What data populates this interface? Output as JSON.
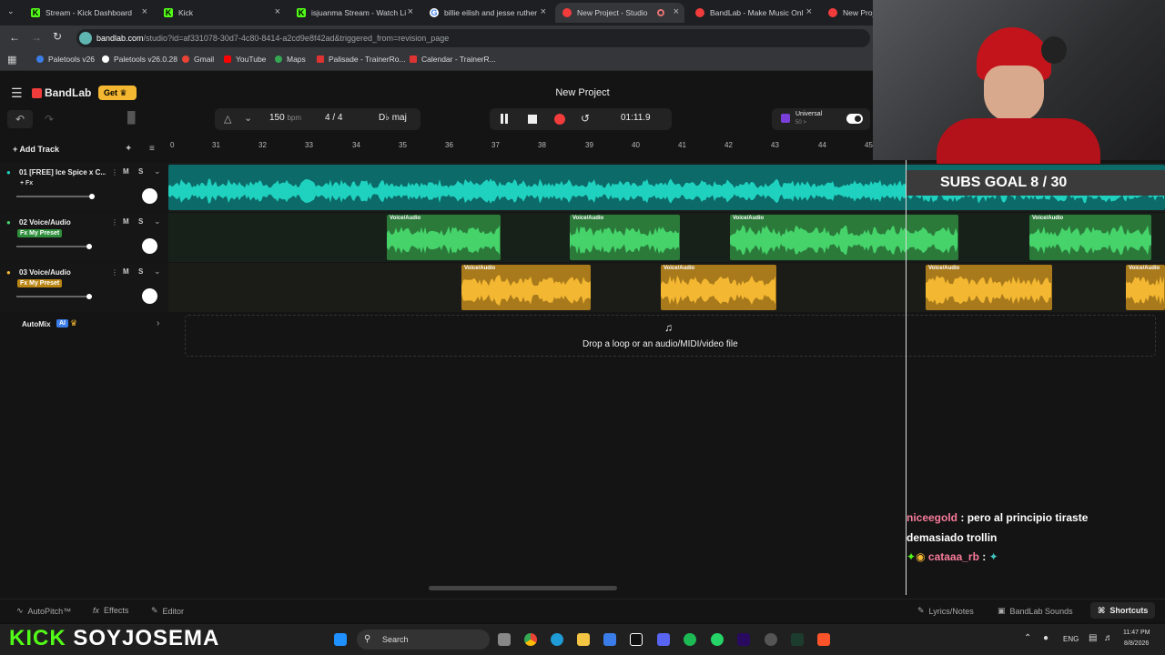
{
  "browser": {
    "tabs": [
      {
        "label": "Stream - Kick Dashboard",
        "favicon": "kick-icon"
      },
      {
        "label": "Kick",
        "favicon": "kick-icon"
      },
      {
        "label": "isjuanma Stream - Watch Li",
        "favicon": "kick-icon"
      },
      {
        "label": "billie eilish and jesse ruther",
        "favicon": "google-icon"
      },
      {
        "label": "New Project - Studio",
        "favicon": "bandlab-icon",
        "active": true
      },
      {
        "label": "BandLab - Make Music Onl",
        "favicon": "bandlab-icon"
      },
      {
        "label": "New Proje",
        "favicon": "bandlab-icon"
      }
    ],
    "url_domain": "bandlab.com",
    "url_rest": "/studio?id=af331078-30d7-4c80-8414-a2cd9e8f42ad&triggered_from=revision_page",
    "bookmarks": [
      "Paletools v26",
      "Paletools v26.0.28",
      "Gmail",
      "YouTube",
      "Maps",
      "Palisade - TrainerRo...",
      "Calendar - TrainerR..."
    ]
  },
  "app": {
    "logo": "BandLab",
    "get_label": "Get",
    "title": "New Project",
    "tempo": "150",
    "tempo_unit": "bpm",
    "time_signature": "4 / 4",
    "key": "D♭ maj",
    "time_display": "01:11.9",
    "instrument_preset": "Universal",
    "instrument_sub": "50 >",
    "add_track_label": "Add Track",
    "drop_hint": "Drop a loop or an audio/MIDI/video file",
    "automix_label": "AutoMix",
    "automix_badge": "AI"
  },
  "ruler": [
    "0",
    "31",
    "32",
    "33",
    "34",
    "35",
    "36",
    "37",
    "38",
    "39",
    "40",
    "41",
    "42",
    "43",
    "44",
    "45"
  ],
  "tracks": [
    {
      "name": "01 [FREE] Ice Spice x C...",
      "fx": "+ Fx",
      "fx_style": "plain",
      "color": "#1fd2c0",
      "volume": 0.8,
      "clips": [
        {
          "label": ""
        }
      ]
    },
    {
      "name": "02 Voice/Audio",
      "fx": "Fx My Preset",
      "fx_style": "green",
      "color": "#45d36a",
      "volume": 0.8,
      "clips": [
        {
          "label": "Voice/Audio"
        },
        {
          "label": "Voice/Audio"
        },
        {
          "label": "Voice/Audio"
        },
        {
          "label": "Voice/Audio"
        }
      ]
    },
    {
      "name": "03 Voice/Audio",
      "fx": "Fx My Preset",
      "fx_style": "yellow",
      "color": "#f4b731",
      "volume": 0.8,
      "clips": [
        {
          "label": "Voice/Audio"
        },
        {
          "label": "Voice/Audio"
        },
        {
          "label": "Voice/Audio"
        },
        {
          "label": "Voice/Audio"
        }
      ]
    }
  ],
  "track_buttons": {
    "mute": "M",
    "solo": "S"
  },
  "overlay": {
    "subs_goal": "SUBS GOAL 8 / 30",
    "chat": [
      {
        "user": "niceegold",
        "message": "pero al principio tiraste demasiado trollin",
        "user_color": "#f77b9a"
      },
      {
        "user": "cataaa_rb",
        "message": "",
        "user_color": "#f77b9a"
      }
    ],
    "stream_brand": "KICK",
    "streamer": "SOYJOSEMA"
  },
  "bottom": {
    "autopitch": "AutoPitch™",
    "effects": "Effects",
    "editor": "Editor",
    "lyrics": "Lyrics/Notes",
    "sounds": "BandLab Sounds",
    "shortcuts": "Shortcuts"
  },
  "taskbar": {
    "search": "Search",
    "lang": "ENG",
    "time": "11:47 PM",
    "date": "8/8/2026"
  },
  "colors": {
    "accent": "#f4b731",
    "bandlab_red": "#f23c3c",
    "teal": "#1fd2c0",
    "green": "#45d36a"
  }
}
